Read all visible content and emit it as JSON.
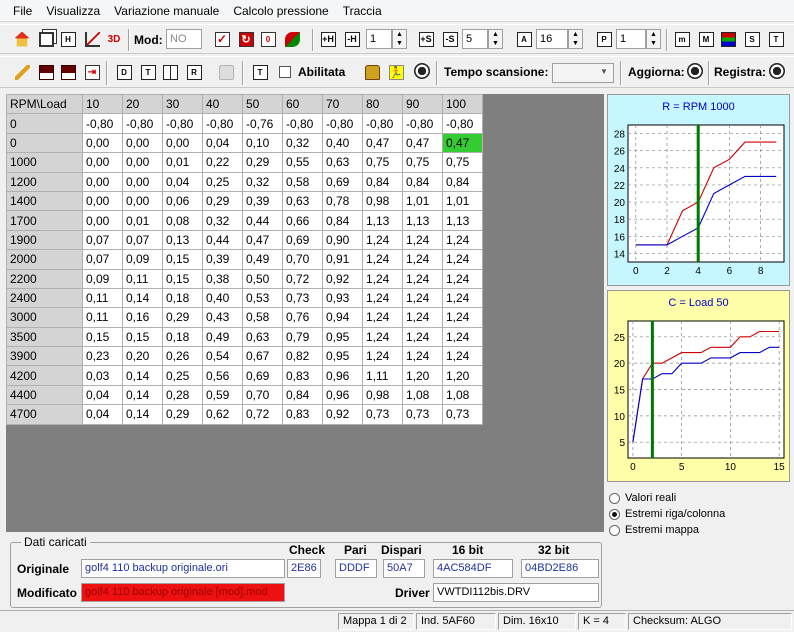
{
  "menu": [
    "File",
    "Visualizza",
    "Variazione manuale",
    "Calcolo pressione",
    "Traccia"
  ],
  "toolbar1": {
    "mod_label": "Mod:",
    "mod_value": "NO",
    "spin1": "1",
    "spin2": "5",
    "spin3": "16",
    "spin4": "1"
  },
  "toolbar2": {
    "abilitata_label": "Abilitata",
    "tempo_label": "Tempo scansione:",
    "tempo_value": "",
    "aggiorna_label": "Aggiorna:",
    "registra_label": "Registra:"
  },
  "grid": {
    "corner": "RPM\\Load",
    "columns": [
      "10",
      "20",
      "30",
      "40",
      "50",
      "60",
      "70",
      "80",
      "90",
      "100"
    ],
    "rows": [
      {
        "rpm": "0",
        "values": [
          "-0,80",
          "-0,80",
          "-0,80",
          "-0,80",
          "-0,76",
          "-0,80",
          "-0,80",
          "-0,80",
          "-0,80",
          "-0,80"
        ]
      },
      {
        "rpm": "0",
        "values": [
          "0,00",
          "0,00",
          "0,00",
          "0,04",
          "0,10",
          "0,32",
          "0,40",
          "0,47",
          "0,47",
          "0,47"
        ]
      },
      {
        "rpm": "1000",
        "values": [
          "0,00",
          "0,00",
          "0,01",
          "0,22",
          "0,29",
          "0,55",
          "0,63",
          "0,75",
          "0,75",
          "0,75"
        ]
      },
      {
        "rpm": "1200",
        "values": [
          "0,00",
          "0,00",
          "0,04",
          "0,25",
          "0,32",
          "0,58",
          "0,69",
          "0,84",
          "0,84",
          "0,84"
        ]
      },
      {
        "rpm": "1400",
        "values": [
          "0,00",
          "0,00",
          "0,06",
          "0,29",
          "0,39",
          "0,63",
          "0,78",
          "0,98",
          "1,01",
          "1,01"
        ]
      },
      {
        "rpm": "1700",
        "values": [
          "0,00",
          "0,01",
          "0,08",
          "0,32",
          "0,44",
          "0,66",
          "0,84",
          "1,13",
          "1,13",
          "1,13"
        ]
      },
      {
        "rpm": "1900",
        "values": [
          "0,07",
          "0,07",
          "0,13",
          "0,44",
          "0,47",
          "0,69",
          "0,90",
          "1,24",
          "1,24",
          "1,24"
        ]
      },
      {
        "rpm": "2000",
        "values": [
          "0,07",
          "0,09",
          "0,15",
          "0,39",
          "0,49",
          "0,70",
          "0,91",
          "1,24",
          "1,24",
          "1,24"
        ]
      },
      {
        "rpm": "2200",
        "values": [
          "0,09",
          "0,11",
          "0,15",
          "0,38",
          "0,50",
          "0,72",
          "0,92",
          "1,24",
          "1,24",
          "1,24"
        ]
      },
      {
        "rpm": "2400",
        "values": [
          "0,11",
          "0,14",
          "0,18",
          "0,40",
          "0,53",
          "0,73",
          "0,93",
          "1,24",
          "1,24",
          "1,24"
        ]
      },
      {
        "rpm": "3000",
        "values": [
          "0,11",
          "0,16",
          "0,29",
          "0,43",
          "0,58",
          "0,76",
          "0,94",
          "1,24",
          "1,24",
          "1,24"
        ]
      },
      {
        "rpm": "3500",
        "values": [
          "0,15",
          "0,15",
          "0,18",
          "0,49",
          "0,63",
          "0,79",
          "0,95",
          "1,24",
          "1,24",
          "1,24"
        ]
      },
      {
        "rpm": "3900",
        "values": [
          "0,23",
          "0,20",
          "0,26",
          "0,54",
          "0,67",
          "0,82",
          "0,95",
          "1,24",
          "1,24",
          "1,24"
        ]
      },
      {
        "rpm": "4200",
        "values": [
          "0,03",
          "0,14",
          "0,25",
          "0,56",
          "0,69",
          "0,83",
          "0,96",
          "1,11",
          "1,20",
          "1,20"
        ]
      },
      {
        "rpm": "4400",
        "values": [
          "0,04",
          "0,14",
          "0,28",
          "0,59",
          "0,70",
          "0,84",
          "0,96",
          "0,98",
          "1,08",
          "1,08"
        ]
      },
      {
        "rpm": "4700",
        "values": [
          "0,04",
          "0,14",
          "0,29",
          "0,62",
          "0,72",
          "0,83",
          "0,92",
          "0,73",
          "0,73",
          "0,73"
        ]
      }
    ],
    "highlight": {
      "row": 1,
      "col": 9,
      "color": "#33cc33"
    }
  },
  "chart_data": [
    {
      "type": "line",
      "title": "R = RPM 1000",
      "x": [
        0,
        1,
        2,
        3,
        4,
        5,
        6,
        7,
        8,
        9
      ],
      "xticks": [
        0,
        2,
        4,
        6,
        8
      ],
      "yticks": [
        14,
        16,
        18,
        20,
        22,
        24,
        26,
        28
      ],
      "xlim": [
        -0.5,
        9.5
      ],
      "ylim": [
        13,
        29
      ],
      "marker_x": 4,
      "marker_color": "#007700",
      "series": [
        {
          "color": "#cc0000",
          "values": [
            15,
            15,
            15,
            19,
            20,
            24,
            25,
            27,
            27,
            27
          ]
        },
        {
          "color": "#0000cc",
          "values": [
            15,
            15,
            15,
            16,
            17,
            21,
            22,
            23,
            23,
            23
          ]
        }
      ]
    },
    {
      "type": "line",
      "title": "C = Load 50",
      "x": [
        0,
        1,
        2,
        3,
        4,
        5,
        6,
        7,
        8,
        9,
        10,
        11,
        12,
        13,
        14,
        15
      ],
      "xticks": [
        0,
        5,
        10,
        15
      ],
      "yticks": [
        5,
        10,
        15,
        20,
        25
      ],
      "xlim": [
        -0.5,
        15.5
      ],
      "ylim": [
        2,
        28
      ],
      "marker_x": 2,
      "marker_color": "#007700",
      "series": [
        {
          "color": "#cc0000",
          "values": [
            5,
            17,
            20,
            20,
            21,
            22,
            22,
            22,
            23,
            23,
            23,
            25,
            25,
            26,
            26,
            26
          ]
        },
        {
          "color": "#0000cc",
          "values": [
            5,
            17,
            17,
            18,
            18,
            20,
            20,
            20,
            21,
            21,
            21,
            22,
            22,
            22,
            23,
            23
          ]
        }
      ]
    }
  ],
  "view_options": [
    {
      "label": "Valori reali",
      "selected": false
    },
    {
      "label": "Estremi riga/colonna",
      "selected": true
    },
    {
      "label": "Estremi mappa",
      "selected": false
    }
  ],
  "dati": {
    "legend": "Dati caricati",
    "col_check": "Check",
    "col_pari": "Pari",
    "col_dispari": "Dispari",
    "col_16bit": "16 bit",
    "col_32bit": "32 bit",
    "originale_label": "Originale",
    "originale_file": "golf4 110 backup originale.ori",
    "check": "2E86",
    "pari": "DDDF",
    "dispari": "50A7",
    "bit16": "4AC584DF",
    "bit32": "04BD2E86",
    "modificato_label": "Modificato",
    "modificato_file": "golf4 110 backup originale [mod].mod",
    "driver_label": "Driver",
    "driver_value": "VWTDI112bis.DRV"
  },
  "status": {
    "mappa": "Mappa 1 di 2",
    "ind": "Ind. 5AF60",
    "dim": "Dim. 16x10",
    "k": "K = 4",
    "checksum": "Checksum: ALGO"
  }
}
